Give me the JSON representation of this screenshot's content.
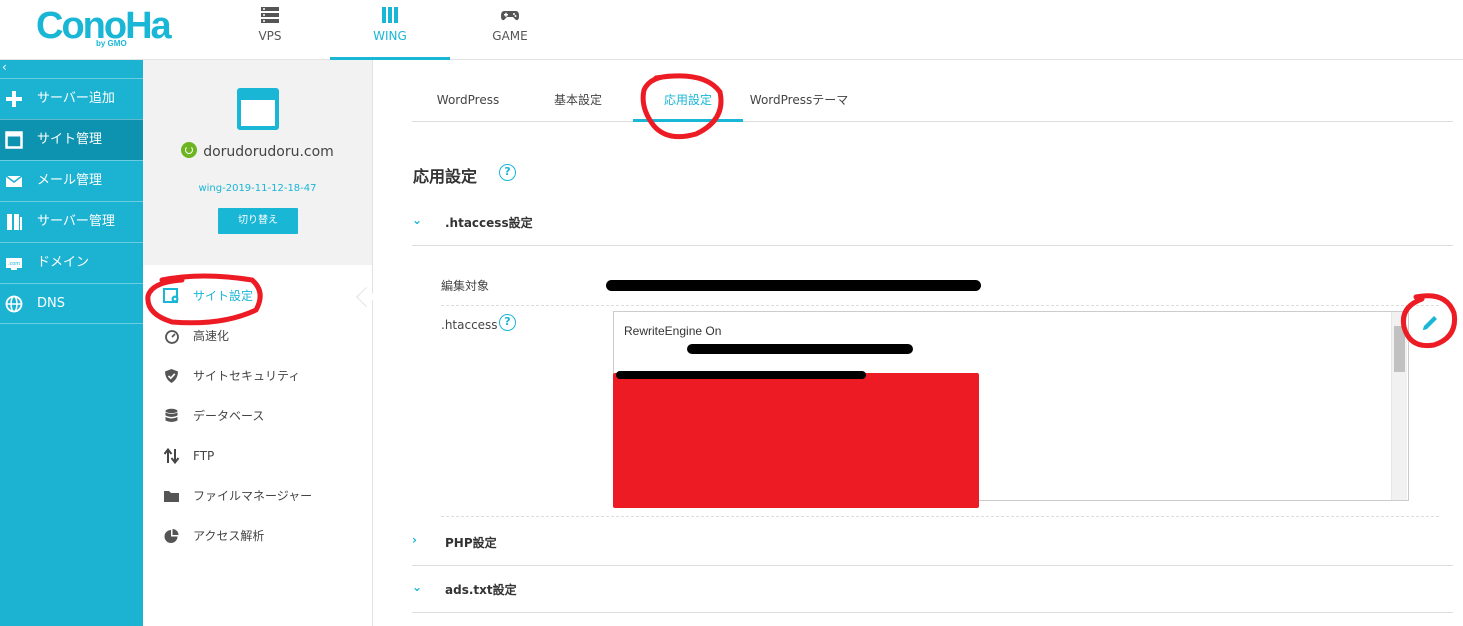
{
  "brand": {
    "logo_text": "ConoHa",
    "logo_sub": "by GMO"
  },
  "top_nav": [
    {
      "label": "VPS",
      "icon": "server-icon",
      "active": false
    },
    {
      "label": "WING",
      "icon": "wing-icon",
      "active": true
    },
    {
      "label": "GAME",
      "icon": "gamepad-icon",
      "active": false
    }
  ],
  "sidebar": {
    "collapse_glyph": "‹",
    "items": [
      {
        "label": "サーバー追加",
        "icon": "plus-icon"
      },
      {
        "label": "サイト管理",
        "icon": "window-icon",
        "active": true
      },
      {
        "label": "メール管理",
        "icon": "mail-icon"
      },
      {
        "label": "サーバー管理",
        "icon": "server-manage-icon"
      },
      {
        "label": "ドメイン",
        "icon": "domain-icon"
      },
      {
        "label": "DNS",
        "icon": "globe-icon"
      }
    ]
  },
  "site": {
    "domain": "dorudorudoru.com",
    "wing_id": "wing-2019-11-12-18-47",
    "switch_label": "切り替え"
  },
  "site_menu": [
    {
      "label": "サイト設定",
      "icon": "site-settings-icon",
      "active": true
    },
    {
      "label": "高速化",
      "icon": "speed-icon"
    },
    {
      "label": "サイトセキュリティ",
      "icon": "shield-icon"
    },
    {
      "label": "データベース",
      "icon": "database-icon"
    },
    {
      "label": "FTP",
      "icon": "ftp-arrows-icon"
    },
    {
      "label": "ファイルマネージャー",
      "icon": "folder-icon"
    },
    {
      "label": "アクセス解析",
      "icon": "pie-chart-icon"
    }
  ],
  "tabs": [
    {
      "label": "WordPress"
    },
    {
      "label": "基本設定"
    },
    {
      "label": "応用設定",
      "active": true
    },
    {
      "label": "WordPressテーマ"
    }
  ],
  "heading": "応用設定",
  "help_glyph": "?",
  "sections": {
    "htaccess": {
      "title": ".htaccess設定",
      "chevron": "⌄"
    },
    "php": {
      "title": "PHP設定",
      "chevron": "›"
    },
    "ads": {
      "title": "ads.txt設定",
      "chevron": "⌄"
    }
  },
  "fields": {
    "edit_target_label": "編集対象",
    "htaccess_label": ".htaccess",
    "htaccess_first_line": "RewriteEngine On"
  },
  "colors": {
    "accent": "#19b6d6",
    "sidebar": "#1cb3d3",
    "sidebar_active": "#0d93af",
    "annotation": "#ed1c24"
  }
}
